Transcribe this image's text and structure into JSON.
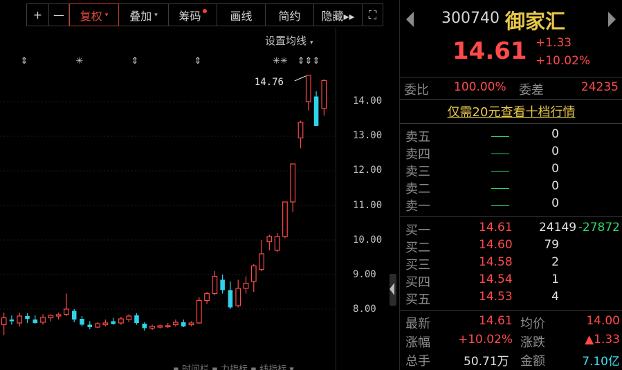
{
  "toolbar": {
    "buttons": [
      {
        "label": "+"
      },
      {
        "label": "—"
      },
      {
        "label": "复权",
        "caret": "▾"
      },
      {
        "label": "叠加",
        "caret": "▾"
      },
      {
        "label": "筹码"
      },
      {
        "label": "画线"
      },
      {
        "label": "简约"
      },
      {
        "label": "隐藏▸▸"
      },
      {
        "label": "⛶"
      }
    ]
  },
  "ma_settings": {
    "label": "设置均线",
    "caret": "▾"
  },
  "chart": {
    "y_ticks": [
      "14.00",
      "13.00",
      "12.00",
      "11.00",
      "10.00",
      "9.00",
      "8.00"
    ],
    "high_annotation": "14.76",
    "event_markers": [
      "⇕",
      "✳",
      "⇕",
      "⇕",
      "✳✳",
      "⇕⇕⇕"
    ],
    "bottom_strip_text": "▪ 时间栏  ▪ 力指标 ▪ 线指标 ▾",
    "colors": {
      "up": "#ff4a4a",
      "down": "#2ed3ea"
    }
  },
  "chart_data": {
    "type": "candlestick",
    "ylim": [
      7.3,
      15.2
    ],
    "ohlc": [
      {
        "o": 7.55,
        "h": 7.9,
        "l": 7.25,
        "c": 7.75
      },
      {
        "o": 7.7,
        "h": 7.82,
        "l": 7.55,
        "c": 7.65
      },
      {
        "o": 7.6,
        "h": 7.9,
        "l": 7.5,
        "c": 7.8
      },
      {
        "o": 7.8,
        "h": 7.88,
        "l": 7.6,
        "c": 7.72
      },
      {
        "o": 7.7,
        "h": 7.82,
        "l": 7.58,
        "c": 7.6
      },
      {
        "o": 7.62,
        "h": 7.85,
        "l": 7.55,
        "c": 7.76
      },
      {
        "o": 7.75,
        "h": 7.85,
        "l": 7.65,
        "c": 7.82
      },
      {
        "o": 7.8,
        "h": 7.9,
        "l": 7.7,
        "c": 7.84
      },
      {
        "o": 7.85,
        "h": 8.45,
        "l": 7.8,
        "c": 8.0
      },
      {
        "o": 7.95,
        "h": 8.0,
        "l": 7.62,
        "c": 7.7
      },
      {
        "o": 7.72,
        "h": 7.8,
        "l": 7.5,
        "c": 7.55
      },
      {
        "o": 7.55,
        "h": 7.65,
        "l": 7.42,
        "c": 7.48
      },
      {
        "o": 7.48,
        "h": 7.62,
        "l": 7.45,
        "c": 7.58
      },
      {
        "o": 7.55,
        "h": 7.7,
        "l": 7.5,
        "c": 7.6
      },
      {
        "o": 7.65,
        "h": 7.75,
        "l": 7.55,
        "c": 7.57
      },
      {
        "o": 7.6,
        "h": 7.78,
        "l": 7.55,
        "c": 7.72
      },
      {
        "o": 7.7,
        "h": 7.85,
        "l": 7.62,
        "c": 7.8
      },
      {
        "o": 7.82,
        "h": 7.88,
        "l": 7.55,
        "c": 7.6
      },
      {
        "o": 7.58,
        "h": 7.62,
        "l": 7.38,
        "c": 7.45
      },
      {
        "o": 7.45,
        "h": 7.55,
        "l": 7.4,
        "c": 7.5
      },
      {
        "o": 7.48,
        "h": 7.55,
        "l": 7.44,
        "c": 7.52
      },
      {
        "o": 7.5,
        "h": 7.6,
        "l": 7.46,
        "c": 7.52
      },
      {
        "o": 7.55,
        "h": 7.7,
        "l": 7.5,
        "c": 7.62
      },
      {
        "o": 7.62,
        "h": 7.7,
        "l": 7.48,
        "c": 7.5
      },
      {
        "o": 7.55,
        "h": 7.65,
        "l": 7.5,
        "c": 7.6
      },
      {
        "o": 7.6,
        "h": 8.35,
        "l": 7.58,
        "c": 8.25
      },
      {
        "o": 8.25,
        "h": 8.5,
        "l": 8.15,
        "c": 8.45
      },
      {
        "o": 8.45,
        "h": 9.1,
        "l": 8.4,
        "c": 8.95
      },
      {
        "o": 8.85,
        "h": 9.0,
        "l": 8.45,
        "c": 8.55
      },
      {
        "o": 8.55,
        "h": 8.8,
        "l": 8.0,
        "c": 8.05
      },
      {
        "o": 8.1,
        "h": 8.85,
        "l": 8.05,
        "c": 8.6
      },
      {
        "o": 8.6,
        "h": 8.95,
        "l": 8.45,
        "c": 8.75
      },
      {
        "o": 8.8,
        "h": 9.3,
        "l": 8.5,
        "c": 9.25
      },
      {
        "o": 9.15,
        "h": 10.0,
        "l": 9.1,
        "c": 9.6
      },
      {
        "o": 9.95,
        "h": 10.15,
        "l": 9.7,
        "c": 10.1
      },
      {
        "o": 9.7,
        "h": 10.2,
        "l": 9.65,
        "c": 10.1
      },
      {
        "o": 10.1,
        "h": 11.1,
        "l": 10.05,
        "c": 11.1
      },
      {
        "o": 11.1,
        "h": 12.2,
        "l": 10.8,
        "c": 12.2
      },
      {
        "o": 12.95,
        "h": 13.45,
        "l": 12.65,
        "c": 13.4
      },
      {
        "o": 14.0,
        "h": 14.76,
        "l": 13.75,
        "c": 14.76
      },
      {
        "o": 14.15,
        "h": 14.3,
        "l": 13.3,
        "c": 13.3
      },
      {
        "o": 13.8,
        "h": 14.65,
        "l": 13.6,
        "c": 14.61
      }
    ]
  },
  "quote": {
    "code": "300740",
    "name": "御家汇",
    "last": "14.61",
    "change": "+1.33",
    "change_pct": "+10.02%",
    "webi_label": "委比",
    "webi_value": "100.00%",
    "weicha_label": "委差",
    "weicha_value": "24235",
    "level10_link": "仅需20元查看十档行情",
    "asks": [
      {
        "label": "卖五",
        "price": "—",
        "vol": "0"
      },
      {
        "label": "卖四",
        "price": "—",
        "vol": "0"
      },
      {
        "label": "卖三",
        "price": "—",
        "vol": "0"
      },
      {
        "label": "卖二",
        "price": "—",
        "vol": "0"
      },
      {
        "label": "卖一",
        "price": "—",
        "vol": "0"
      }
    ],
    "bids": [
      {
        "label": "买一",
        "price": "14.61",
        "vol": "24149",
        "extra": "-27872"
      },
      {
        "label": "买二",
        "price": "14.60",
        "vol": "79",
        "extra": ""
      },
      {
        "label": "买三",
        "price": "14.58",
        "vol": "2",
        "extra": ""
      },
      {
        "label": "买四",
        "price": "14.54",
        "vol": "1",
        "extra": ""
      },
      {
        "label": "买五",
        "price": "14.53",
        "vol": "4",
        "extra": ""
      }
    ],
    "stats": {
      "latest_label": "最新",
      "latest_value": "14.61",
      "avg_label": "均价",
      "avg_value": "14.00",
      "pct_label": "涨幅",
      "pct_value": "+10.02%",
      "chg_label": "涨跌",
      "chg_value": "▲1.33",
      "vol_label": "总手",
      "vol_value": "50.71万",
      "amt_label": "金额",
      "amt_value": "7.10亿"
    }
  }
}
